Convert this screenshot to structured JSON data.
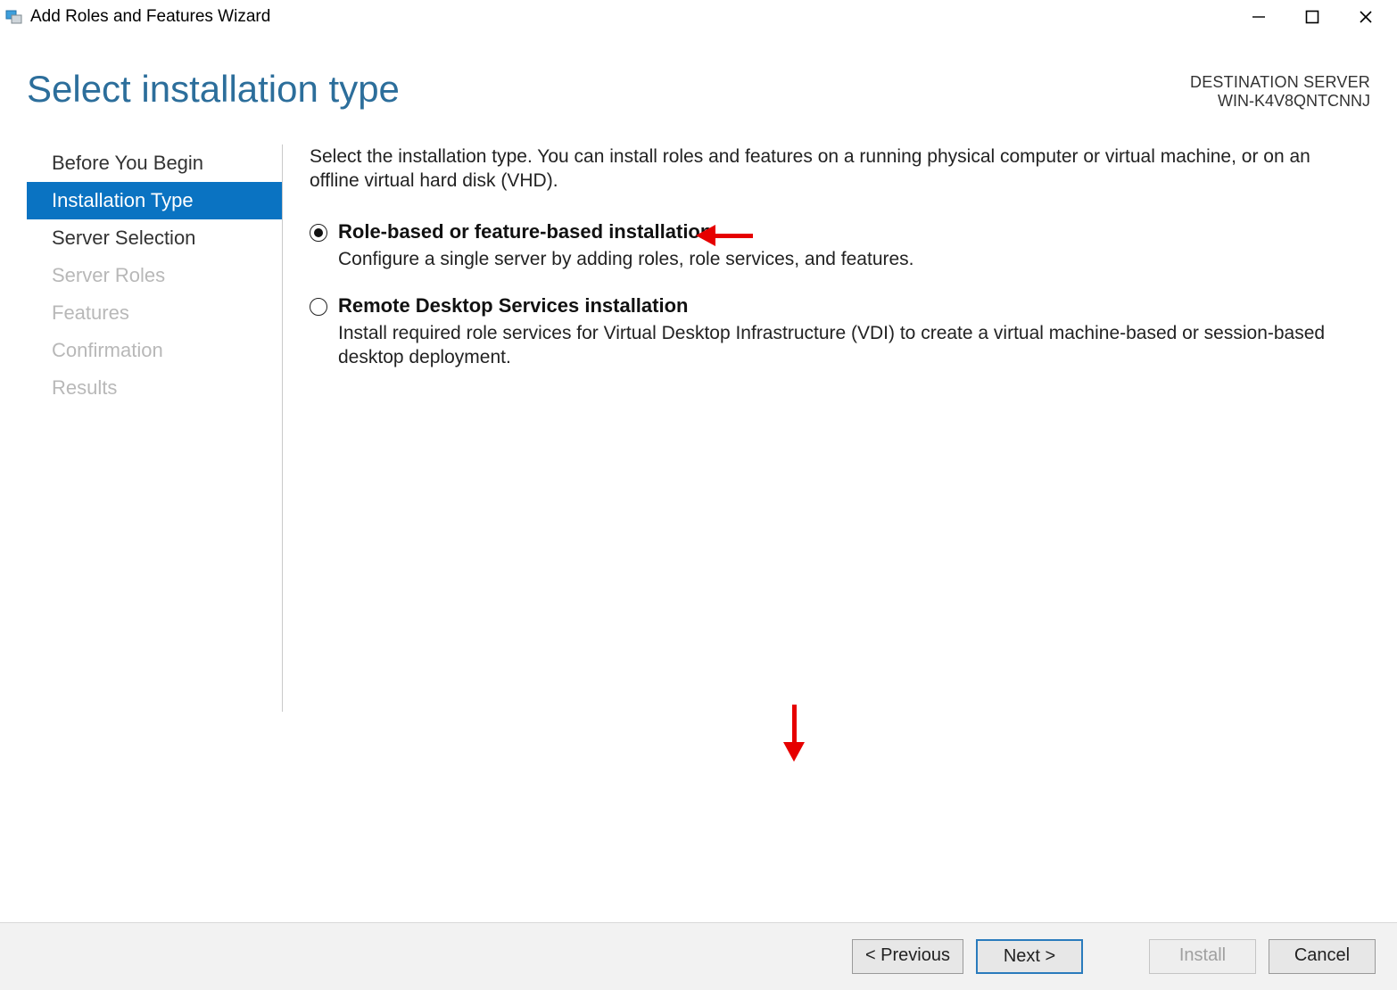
{
  "window": {
    "title": "Add Roles and Features Wizard"
  },
  "header": {
    "page_title": "Select installation type",
    "destination_label": "DESTINATION SERVER",
    "destination_name": "WIN-K4V8QNTCNNJ"
  },
  "sidebar": {
    "items": [
      {
        "label": "Before You Begin",
        "state": "enabled"
      },
      {
        "label": "Installation Type",
        "state": "selected"
      },
      {
        "label": "Server Selection",
        "state": "enabled"
      },
      {
        "label": "Server Roles",
        "state": "disabled"
      },
      {
        "label": "Features",
        "state": "disabled"
      },
      {
        "label": "Confirmation",
        "state": "disabled"
      },
      {
        "label": "Results",
        "state": "disabled"
      }
    ]
  },
  "content": {
    "intro": "Select the installation type. You can install roles and features on a running physical computer or virtual machine, or on an offline virtual hard disk (VHD).",
    "options": [
      {
        "title": "Role-based or feature-based installation",
        "desc": "Configure a single server by adding roles, role services, and features.",
        "selected": true
      },
      {
        "title": "Remote Desktop Services installation",
        "desc": "Install required role services for Virtual Desktop Infrastructure (VDI) to create a virtual machine-based or session-based desktop deployment.",
        "selected": false
      }
    ]
  },
  "footer": {
    "previous": "< Previous",
    "next": "Next >",
    "install": "Install",
    "cancel": "Cancel"
  }
}
